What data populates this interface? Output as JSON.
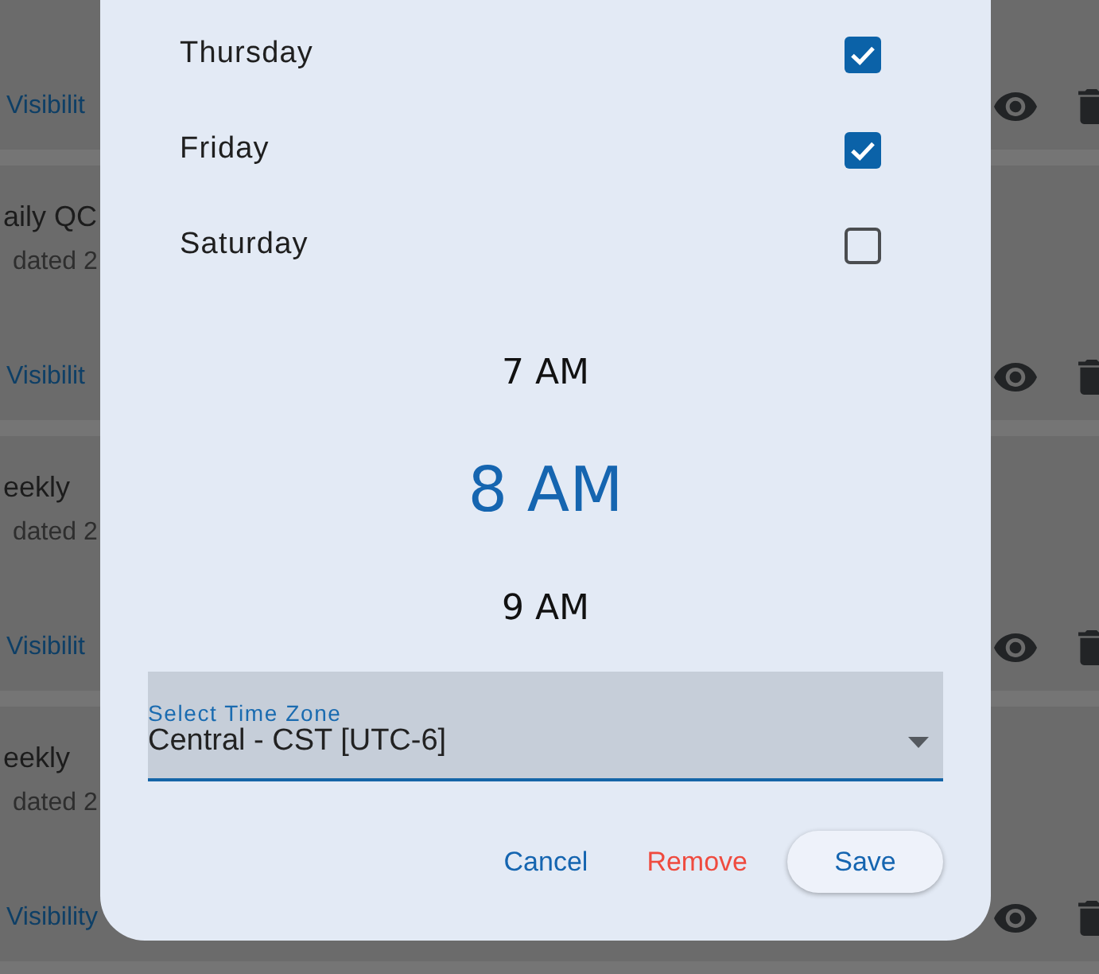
{
  "background_cards": [
    {
      "link": "Visibilit"
    },
    {
      "title": "aily QC",
      "subtitle": "dated 2",
      "link": "Visibilit"
    },
    {
      "title": "eekly",
      "subtitle": "dated 2",
      "link": "Visibilit"
    },
    {
      "title": "eekly",
      "subtitle": "dated 2",
      "link": "Visibility"
    }
  ],
  "dialog": {
    "weekdays": [
      {
        "label": "Thursday",
        "checked": true
      },
      {
        "label": "Friday",
        "checked": true
      },
      {
        "label": "Saturday",
        "checked": false
      }
    ],
    "time_picker": {
      "options": [
        {
          "label": "7 AM",
          "selected": false
        },
        {
          "label": "8 AM",
          "selected": true
        },
        {
          "label": "9 AM",
          "selected": false
        }
      ]
    },
    "time_zone_select": {
      "label": "Select Time Zone",
      "value": "Central - CST [UTC-6]"
    },
    "buttons": [
      {
        "label": "Cancel",
        "kind": "text"
      },
      {
        "label": "Remove",
        "kind": "danger"
      },
      {
        "label": "Save",
        "kind": "filled"
      }
    ]
  }
}
